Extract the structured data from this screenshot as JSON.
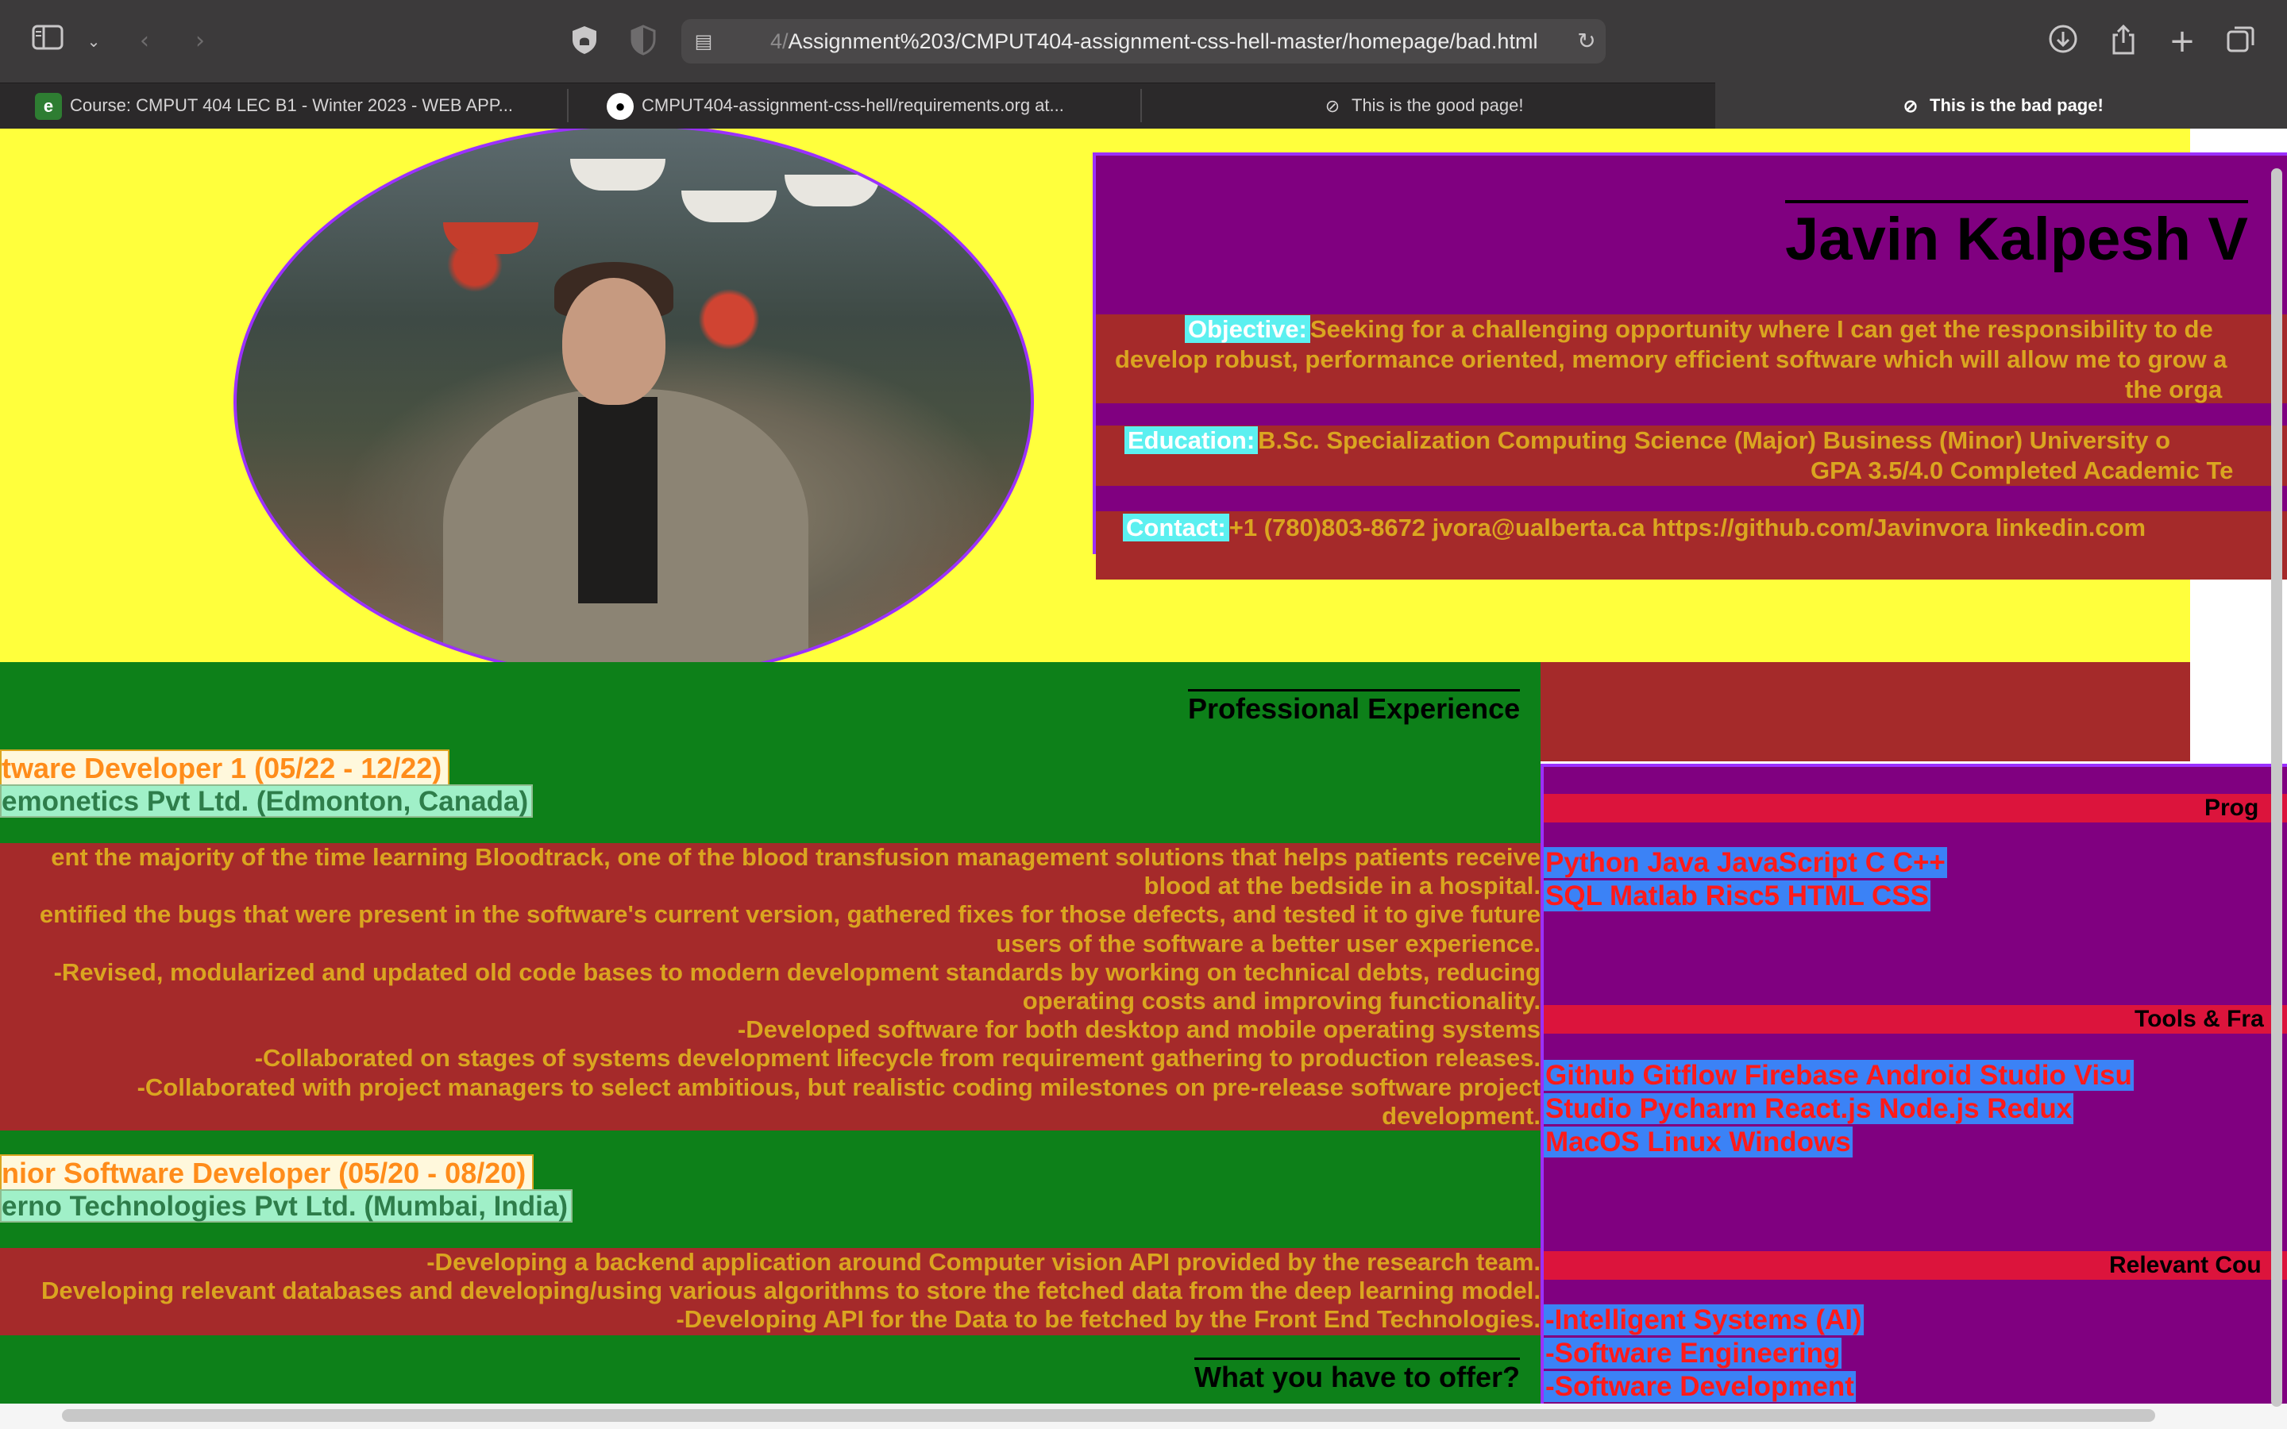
{
  "browser": {
    "url_prefix": "4/",
    "url": "Assignment%203/CMPUT404-assignment-css-hell-master/homepage/bad.html",
    "tabs": [
      {
        "label": "Course: CMPUT 404 LEC B1 - Winter 2023 - WEB APP..."
      },
      {
        "label": "CMPUT404-assignment-css-hell/requirements.org at..."
      },
      {
        "label": "This is the good page!"
      },
      {
        "label": "This is the bad page!"
      }
    ],
    "icons": [
      "sidebar-icon",
      "chevron-down-icon",
      "back-icon",
      "forward-icon",
      "privacy-icon",
      "shield-icon",
      "reader-icon",
      "reload-icon",
      "download-icon",
      "share-icon",
      "new-tab-icon",
      "tab-overview-icon"
    ]
  },
  "header": {
    "name": "Javin Kalpesh V",
    "objective_label": "Objective:",
    "objective_line1": "Seeking for a challenging opportunity where I can get the responsibility to de",
    "objective_line2": "develop robust, performance oriented, memory efficient software which will allow me to grow a",
    "objective_line3": "the orga",
    "education_label": "Education:",
    "education_line1": "B.Sc. Specialization   Computing Science (Major)   Business (Minor)   University o",
    "education_line2": "GPA 3.5/4.0   Completed Academic Te",
    "contact_label": "Contact:",
    "contact_line": "+1 (780)803-8672    jvora@ualberta.ca     https://github.com/Javinvora    linkedin.com"
  },
  "experience": {
    "title": "Professional Experience",
    "jobs": [
      {
        "title": "tware Developer 1 (05/22 - 12/22)",
        "company": "emonetics Pvt Ltd. (Edmonton, Canada)",
        "duties": [
          "ent the majority of the time learning Bloodtrack, one of the blood transfusion management solutions that helps patients receive",
          "blood at the bedside in a hospital.",
          "entified the bugs that were present in the software's current version, gathered fixes for those defects, and tested it to give future",
          "users of the software a better user experience.",
          "-Revised, modularized and updated old code bases to modern development standards by working on technical debts, reducing",
          "operating costs and improving functionality.",
          "-Developed software for both desktop and mobile operating systems",
          "-Collaborated on stages of systems development lifecycle from requirement gathering to production releases.",
          "-Collaborated with project managers to select ambitious, but realistic coding milestones on pre-release software project",
          "development."
        ]
      },
      {
        "title": "nior Software Developer (05/20 - 08/20)",
        "company": "erno Technologies Pvt Ltd. (Mumbai, India)",
        "duties": [
          "-Developing a backend application around Computer vision API provided by the research team.",
          "Developing relevant databases and developing/using various algorithms to store the fetched data from the deep learning model.",
          "-Developing API for the Data to be fetched by the Front End Technologies."
        ]
      }
    ],
    "offer_title": "What you have to offer?"
  },
  "sidebar": {
    "programming_title": "Prog",
    "programming_line1": "Python    Java    JavaScript    C   C++",
    "programming_line2": "SQL    Matlab    Risc5    HTML    CSS",
    "tools_title": "Tools & Fra",
    "tools_line1": "Github      Gitflow      Firebase Android Studio      Visu",
    "tools_line2": "Studio      Pycharm React.js      Node.js      Redux",
    "tools_line3": "MacOS      Linux      Windows",
    "courses_title": "Relevant Cou",
    "courses": [
      "-Intelligent Systems (AI)",
      "-Software Engineering",
      "-Software Development"
    ]
  },
  "colors": {
    "yellow_bg": "#ffff3c",
    "purple_panel": "#800080",
    "brown_band": "#a52a2a",
    "green_section": "#0d8019",
    "crimson_bar": "#dc143c",
    "gold_text": "#daa520",
    "cyan_label": "#5cf0f0",
    "blue_chip": "#3b82f6",
    "red_chip_text": "#ff1a1a"
  }
}
